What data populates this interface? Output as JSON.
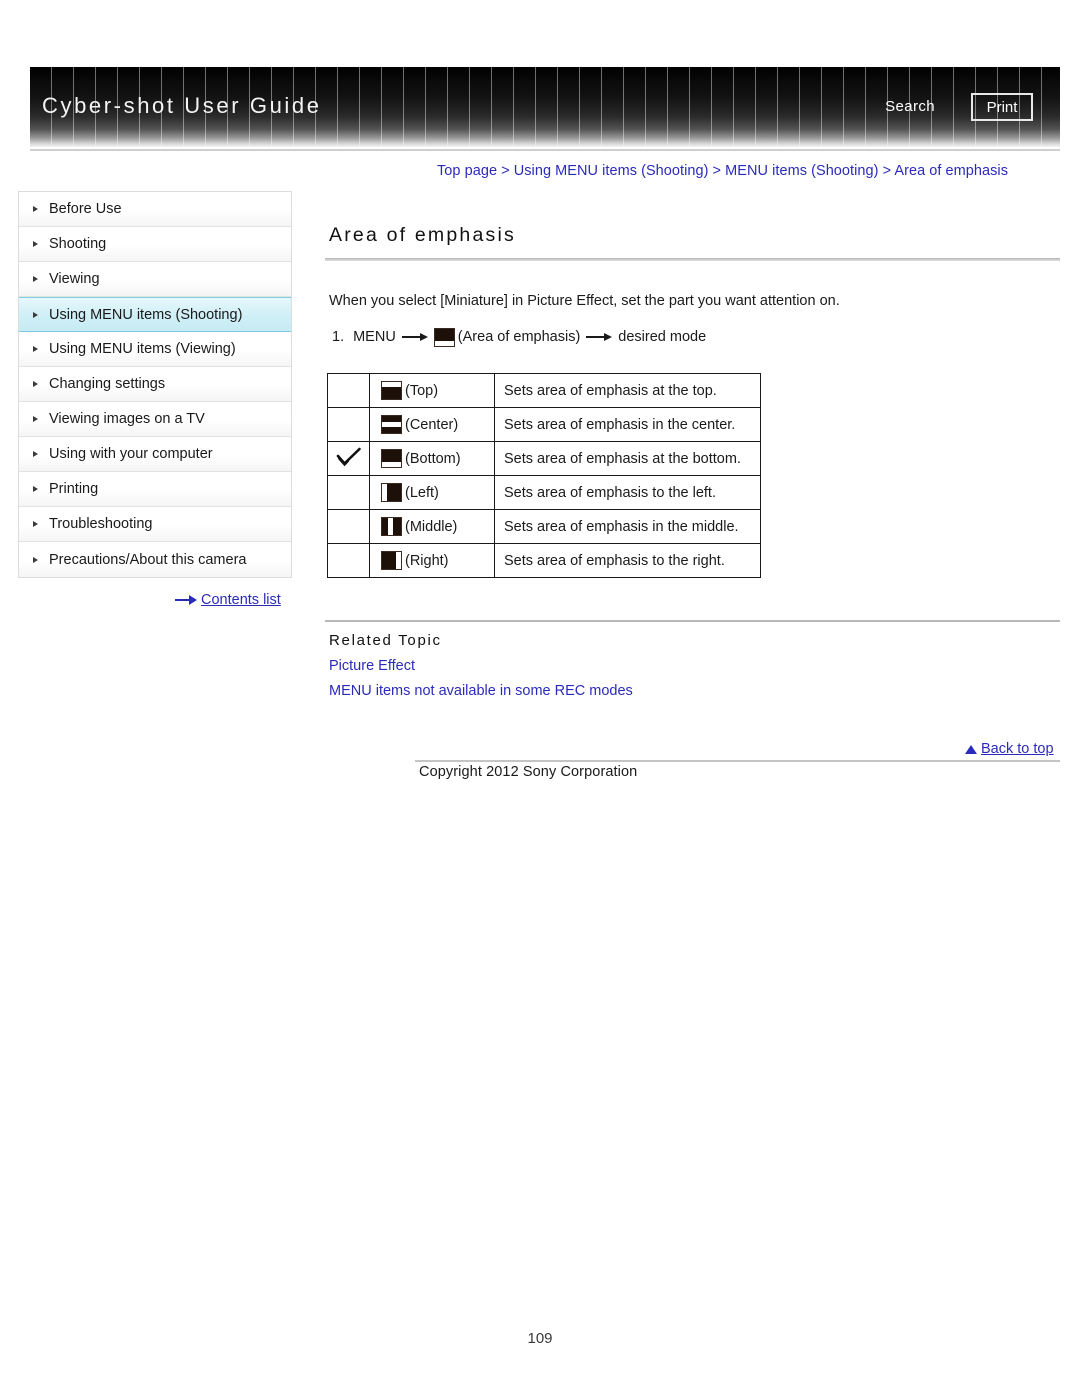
{
  "header": {
    "title": "Cyber-shot User Guide",
    "search_label": "Search",
    "print_label": "Print"
  },
  "breadcrumb": {
    "text": "Top page > Using MENU items (Shooting) > MENU items (Shooting) > Area of emphasis"
  },
  "sidebar": {
    "items": [
      {
        "label": "Before Use",
        "active": false
      },
      {
        "label": "Shooting",
        "active": false
      },
      {
        "label": "Viewing",
        "active": false
      },
      {
        "label": "Using MENU items (Shooting)",
        "active": true
      },
      {
        "label": "Using MENU items (Viewing)",
        "active": false
      },
      {
        "label": "Changing settings",
        "active": false
      },
      {
        "label": "Viewing images on a TV",
        "active": false
      },
      {
        "label": "Using with your computer",
        "active": false
      },
      {
        "label": "Printing",
        "active": false
      },
      {
        "label": "Troubleshooting",
        "active": false
      },
      {
        "label": "Precautions/About this camera",
        "active": false
      }
    ],
    "contents_list_label": "Contents list"
  },
  "main": {
    "title": "Area of emphasis",
    "intro": "When you select [Miniature] in Picture Effect, set the part you want attention on.",
    "step": {
      "number": "1.",
      "menu_label": "MENU",
      "icon_label": "(Area of emphasis)",
      "result_label": "desired mode"
    },
    "table": {
      "rows": [
        {
          "checked": "",
          "icon": "emphasis-bottom-icon",
          "mode": "(Top)",
          "description": "Sets area of emphasis at the top."
        },
        {
          "checked": "",
          "icon": "emphasis-center-icon",
          "mode": "(Center)",
          "description": "Sets area of emphasis in the center."
        },
        {
          "checked": "✓",
          "icon": "emphasis-top-icon",
          "mode": "(Bottom)",
          "description": "Sets area of emphasis at the bottom."
        },
        {
          "checked": "",
          "icon": "emphasis-left-icon",
          "mode": "(Left)",
          "description": "Sets area of emphasis to the left."
        },
        {
          "checked": "",
          "icon": "emphasis-middle-icon",
          "mode": "(Middle)",
          "description": "Sets area of emphasis in the middle."
        },
        {
          "checked": "",
          "icon": "emphasis-right-icon",
          "mode": "(Right)",
          "description": "Sets area of emphasis to the right."
        }
      ]
    },
    "related": {
      "heading": "Related Topic",
      "links": [
        "Picture Effect",
        "MENU items not available in some REC modes"
      ]
    }
  },
  "footer": {
    "back_to_top_label": "Back to top",
    "copyright": "Copyright 2012 Sony Corporation",
    "page_number": "109"
  },
  "colors": {
    "link": "#2b2bbb",
    "sidebar_active_bg": "#cfeff6",
    "sidebar_active_border": "#79cfe0",
    "header_dark": "#000000",
    "rule_gray": "#bdbdbd"
  }
}
